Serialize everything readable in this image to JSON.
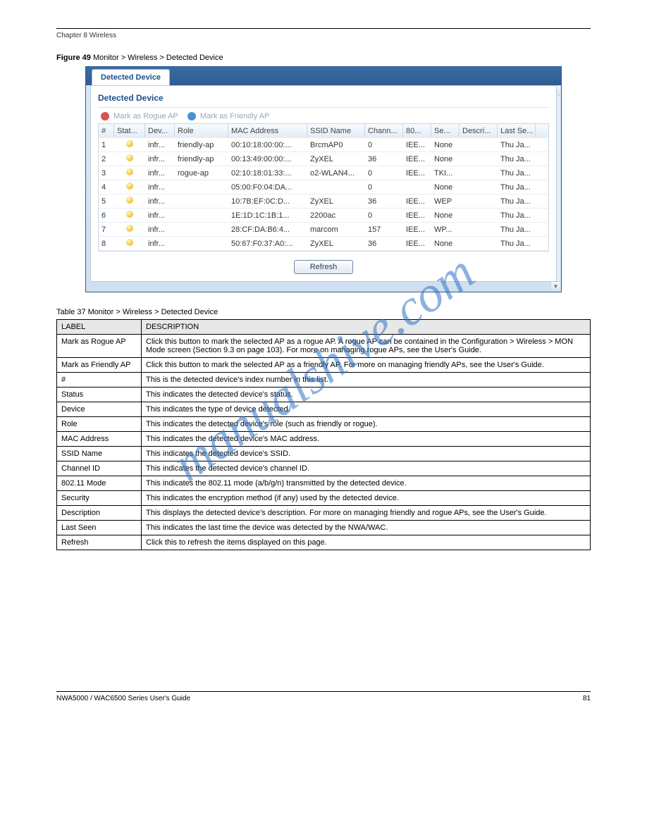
{
  "header": {
    "left": "Chapter 8 Wireless",
    "right": ""
  },
  "figure_caption_strong": "Figure 49",
  "figure_caption_rest": "   Monitor > Wireless > Detected Device",
  "panel": {
    "tab": "Detected Device",
    "title": "Detected Device",
    "mark_rogue": "Mark as Rogue AP",
    "mark_friendly": "Mark as Friendly AP",
    "refresh": "Refresh",
    "cols": [
      "#",
      "Stat...",
      "Dev...",
      "Role",
      "MAC Address",
      "SSID Name",
      "Chann...",
      "80...",
      "Se...",
      "Descri...",
      "Last Se..."
    ],
    "rows": [
      {
        "n": "1",
        "dev": "infr...",
        "role": "friendly-ap",
        "mac": "00:10:18:00:00:...",
        "ssid": "BrcmAP0",
        "ch": "0",
        "m": "IEE...",
        "sec": "None",
        "desc": "",
        "last": "Thu Ja..."
      },
      {
        "n": "2",
        "dev": "infr...",
        "role": "friendly-ap",
        "mac": "00:13:49:00:00:...",
        "ssid": "ZyXEL",
        "ch": "36",
        "m": "IEE...",
        "sec": "None",
        "desc": "",
        "last": "Thu Ja..."
      },
      {
        "n": "3",
        "dev": "infr...",
        "role": "rogue-ap",
        "mac": "02:10:18:01:33:...",
        "ssid": "o2-WLAN4...",
        "ch": "0",
        "m": "IEE...",
        "sec": "TKI...",
        "desc": "",
        "last": "Thu Ja..."
      },
      {
        "n": "4",
        "dev": "infr...",
        "role": "",
        "mac": "05:00:F0:04:DA...",
        "ssid": "",
        "ch": "0",
        "m": "",
        "sec": "None",
        "desc": "",
        "last": "Thu Ja..."
      },
      {
        "n": "5",
        "dev": "infr...",
        "role": "",
        "mac": "10:7B:EF:0C:D...",
        "ssid": "ZyXEL",
        "ch": "36",
        "m": "IEE...",
        "sec": "WEP",
        "desc": "",
        "last": "Thu Ja..."
      },
      {
        "n": "6",
        "dev": "infr...",
        "role": "",
        "mac": "1E:1D:1C:1B:1...",
        "ssid": "2200ac",
        "ch": "0",
        "m": "IEE...",
        "sec": "None",
        "desc": "",
        "last": "Thu Ja..."
      },
      {
        "n": "7",
        "dev": "infr...",
        "role": "",
        "mac": "28:CF:DA:B6:4...",
        "ssid": "marcom",
        "ch": "157",
        "m": "IEE...",
        "sec": "WP...",
        "desc": "",
        "last": "Thu Ja..."
      },
      {
        "n": "8",
        "dev": "infr...",
        "role": "",
        "mac": "50:67:F0:37:A0:...",
        "ssid": "ZyXEL",
        "ch": "36",
        "m": "IEE...",
        "sec": "None",
        "desc": "",
        "last": "Thu Ja..."
      }
    ]
  },
  "table_caption": "Table 37   Monitor > Wireless > Detected Device",
  "thead": [
    "LABEL",
    "DESCRIPTION"
  ],
  "trows": [
    [
      "Mark as Rogue AP",
      "Click this button to mark the selected AP as a rogue AP. A rogue AP can be contained in the Configuration > Wireless > MON Mode screen (Section 9.3 on page 103). For more on managing rogue APs, see the User's Guide."
    ],
    [
      "Mark as Friendly AP",
      "Click this button to mark the selected AP as a friendly AP. For more on managing friendly APs, see the User's Guide."
    ],
    [
      "#",
      "This is the detected device's index number in this list."
    ],
    [
      "Status",
      "This indicates the detected device's status."
    ],
    [
      "Device",
      "This indicates the type of device detected."
    ],
    [
      "Role",
      "This indicates the detected device's role (such as friendly or rogue)."
    ],
    [
      "MAC Address",
      "This indicates the detected device's MAC address."
    ],
    [
      "SSID Name",
      "This indicates the detected device's SSID."
    ],
    [
      "Channel ID",
      "This indicates the detected device's channel ID."
    ],
    [
      "802.11 Mode",
      "This indicates the 802.11 mode (a/b/g/n) transmitted by the detected device."
    ],
    [
      "Security",
      "This indicates the encryption method (if any) used by the detected device."
    ],
    [
      "Description",
      "This displays the detected device's description. For more on managing friendly and rogue APs, see the User's Guide."
    ],
    [
      "Last Seen",
      "This indicates the last time the device was detected by the NWA/WAC."
    ],
    [
      "Refresh",
      "Click this to refresh the items displayed on this page."
    ]
  ],
  "watermark": "manualshive.com",
  "footer": {
    "left": "NWA5000 / WAC6500 Series User's Guide",
    "right": "81"
  }
}
